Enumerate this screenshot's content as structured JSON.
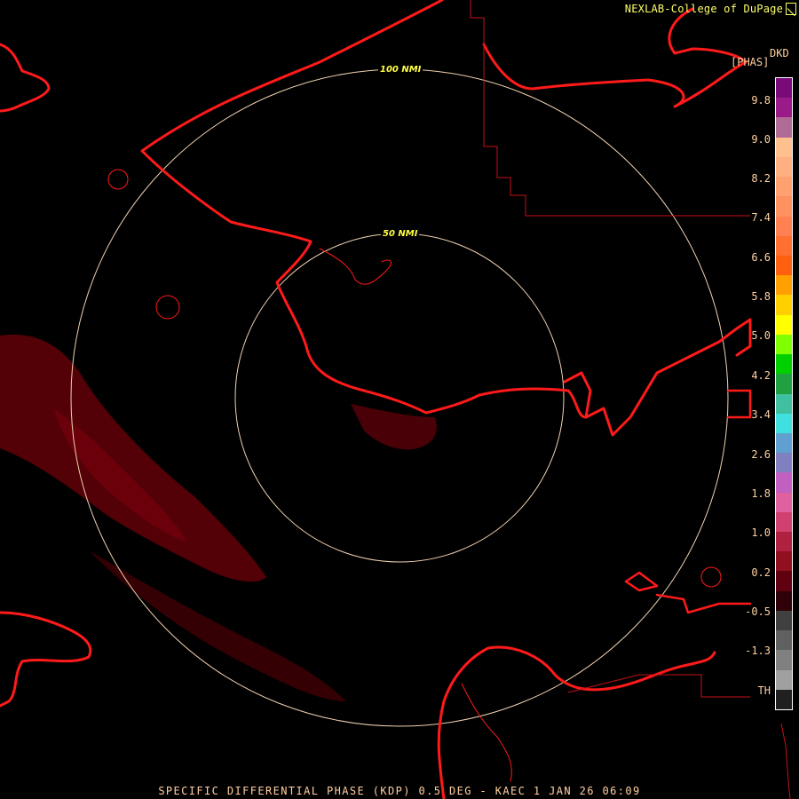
{
  "header": {
    "credit": "NEXLAB-College of DuPage",
    "product_code": "DKD",
    "unit": "[PHAS]"
  },
  "rings": [
    {
      "label": "100 NMI"
    },
    {
      "label": "50 NMI"
    }
  ],
  "legend": {
    "labels": [
      "9.8",
      "9.0",
      "8.2",
      "7.4",
      "6.6",
      "5.8",
      "5.0",
      "4.2",
      "3.4",
      "2.6",
      "1.8",
      "1.0",
      "0.2",
      "-0.5",
      "-1.3",
      "TH"
    ],
    "colors": [
      "#7a0a7a",
      "#9a1a8a",
      "#b06a96",
      "#ffc090",
      "#ffb080",
      "#ffa070",
      "#ff9060",
      "#ff8050",
      "#ff7030",
      "#ff6010",
      "#ffa000",
      "#ffd000",
      "#ffff00",
      "#80ff00",
      "#00d000",
      "#20a040",
      "#40c0a0",
      "#40e0e0",
      "#60a0d0",
      "#8080c0",
      "#c060c0",
      "#e060a0",
      "#d04070",
      "#b02040",
      "#901020",
      "#600010",
      "#300008",
      "#404040",
      "#606060",
      "#808080",
      "#a0a0a0",
      "#202020"
    ]
  },
  "footer": {
    "title": "SPECIFIC DIFFERENTIAL PHASE (KDP) 0.5 DEG - KAEC 1 JAN 26 06:09"
  }
}
